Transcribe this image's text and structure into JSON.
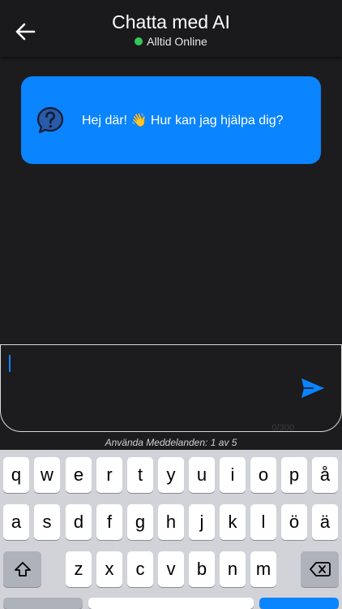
{
  "header": {
    "title": "Chatta med AI",
    "status": "Alltid Online",
    "status_color": "#34c759"
  },
  "chat": {
    "messages": [
      {
        "sender": "ai",
        "text": "Hej där! 👋 Hur kan jag hjälpa dig?",
        "icon": "question-chat-icon"
      }
    ],
    "bubble_color": "#0a84ff"
  },
  "composer": {
    "value": "",
    "char_count": "0/300",
    "send_icon": "send-icon",
    "accent": "#0a84ff"
  },
  "usage": "Använda Meddelanden: 1 av 5",
  "keyboard": {
    "row1": [
      "q",
      "w",
      "e",
      "r",
      "t",
      "y",
      "u",
      "i",
      "o",
      "p",
      "å"
    ],
    "row2": [
      "a",
      "s",
      "d",
      "f",
      "g",
      "h",
      "j",
      "k",
      "l",
      "ö",
      "ä"
    ],
    "row3": [
      "z",
      "x",
      "c",
      "v",
      "b",
      "n",
      "m"
    ],
    "shift_icon": "shift-icon",
    "delete_icon": "backspace-icon"
  }
}
